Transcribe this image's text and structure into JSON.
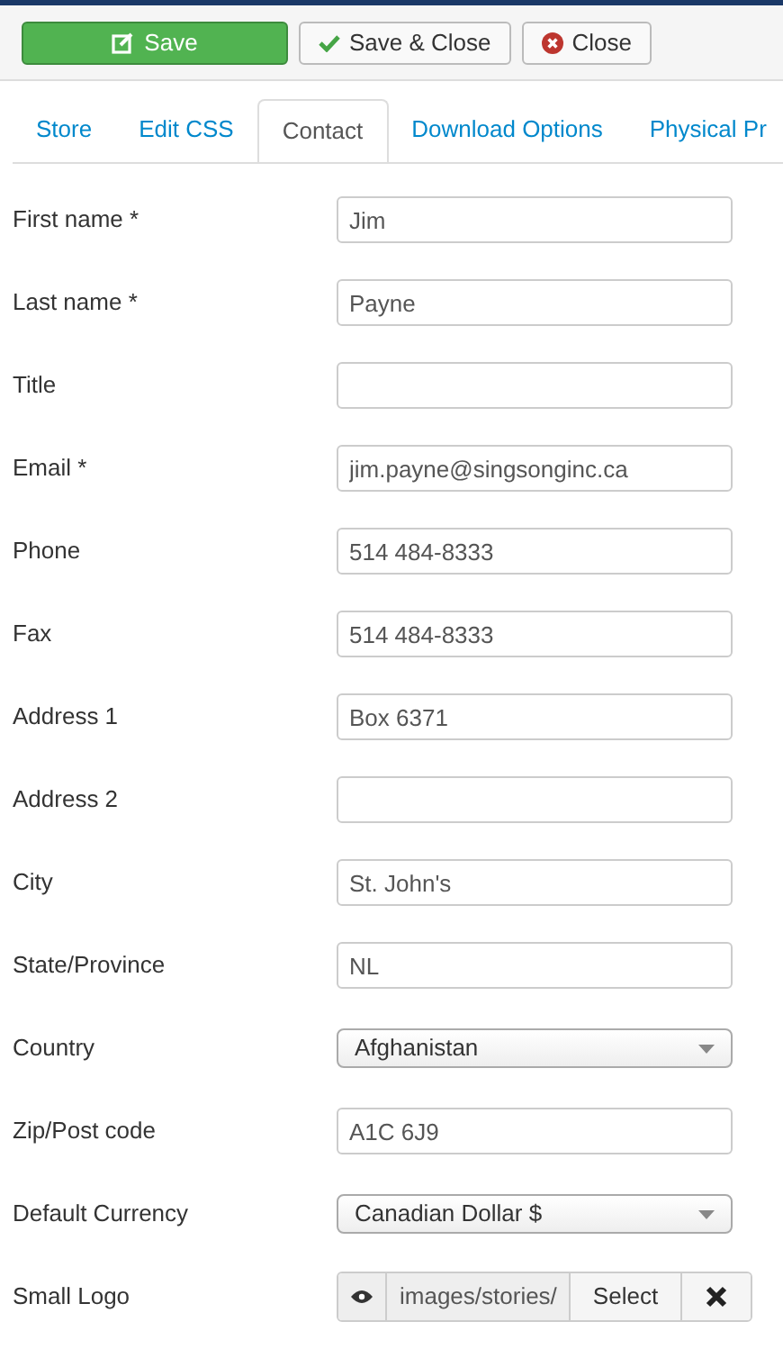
{
  "toolbar": {
    "buttons": [
      {
        "label": "Save",
        "kind": "primary"
      },
      {
        "label": "Save & Close",
        "kind": "check"
      },
      {
        "label": "Close",
        "kind": "close"
      }
    ]
  },
  "tabs": [
    {
      "label": "Store",
      "selected": false
    },
    {
      "label": "Edit CSS",
      "selected": false
    },
    {
      "label": "Contact",
      "selected": true
    },
    {
      "label": "Download Options",
      "selected": false
    },
    {
      "label": "Physical Pr",
      "selected": false
    }
  ],
  "fields": [
    {
      "label": "First name *",
      "kind": "text",
      "value": "Jim"
    },
    {
      "label": "Last name *",
      "kind": "text",
      "value": "Payne"
    },
    {
      "label": "Title",
      "kind": "text"
    },
    {
      "label": "Email *",
      "kind": "text",
      "value": "jim.payne@singsonginc.ca"
    },
    {
      "label": "Phone",
      "kind": "text",
      "value": "514 484-8333"
    },
    {
      "label": "Fax",
      "kind": "text",
      "value": "514 484-8333"
    },
    {
      "label": "Address 1",
      "kind": "text",
      "value": "Box 6371"
    },
    {
      "label": "Address 2",
      "kind": "text"
    },
    {
      "label": "City",
      "kind": "text",
      "value": "St. John's"
    },
    {
      "label": "State/Province",
      "kind": "text",
      "value": "NL"
    },
    {
      "label": "Country",
      "kind": "select",
      "value": "Afghanistan"
    },
    {
      "label": "Zip/Post code",
      "kind": "text",
      "value": "A1C 6J9"
    },
    {
      "label": "Default Currency",
      "kind": "select",
      "value": "Canadian Dollar $"
    },
    {
      "label": "Small Logo",
      "kind": "media",
      "value": "images/stories/",
      "button": "Select"
    }
  ]
}
